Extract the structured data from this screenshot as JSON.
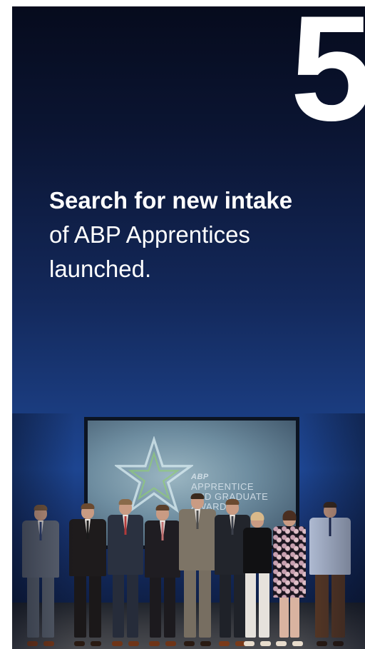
{
  "card": {
    "number": "5",
    "headline_bold": "Search for new intake",
    "headline_line2": "of ABP Apprentices",
    "headline_line3": "launched."
  },
  "photo": {
    "screen_mark": "ABP",
    "screen_line1": "APPRENTICE",
    "screen_line2": "AND GRADUATE",
    "screen_line3": "AWARDS"
  },
  "colors": {
    "gradient_top": "#060b1d",
    "gradient_mid": "#1d4591",
    "text": "#ffffff"
  }
}
